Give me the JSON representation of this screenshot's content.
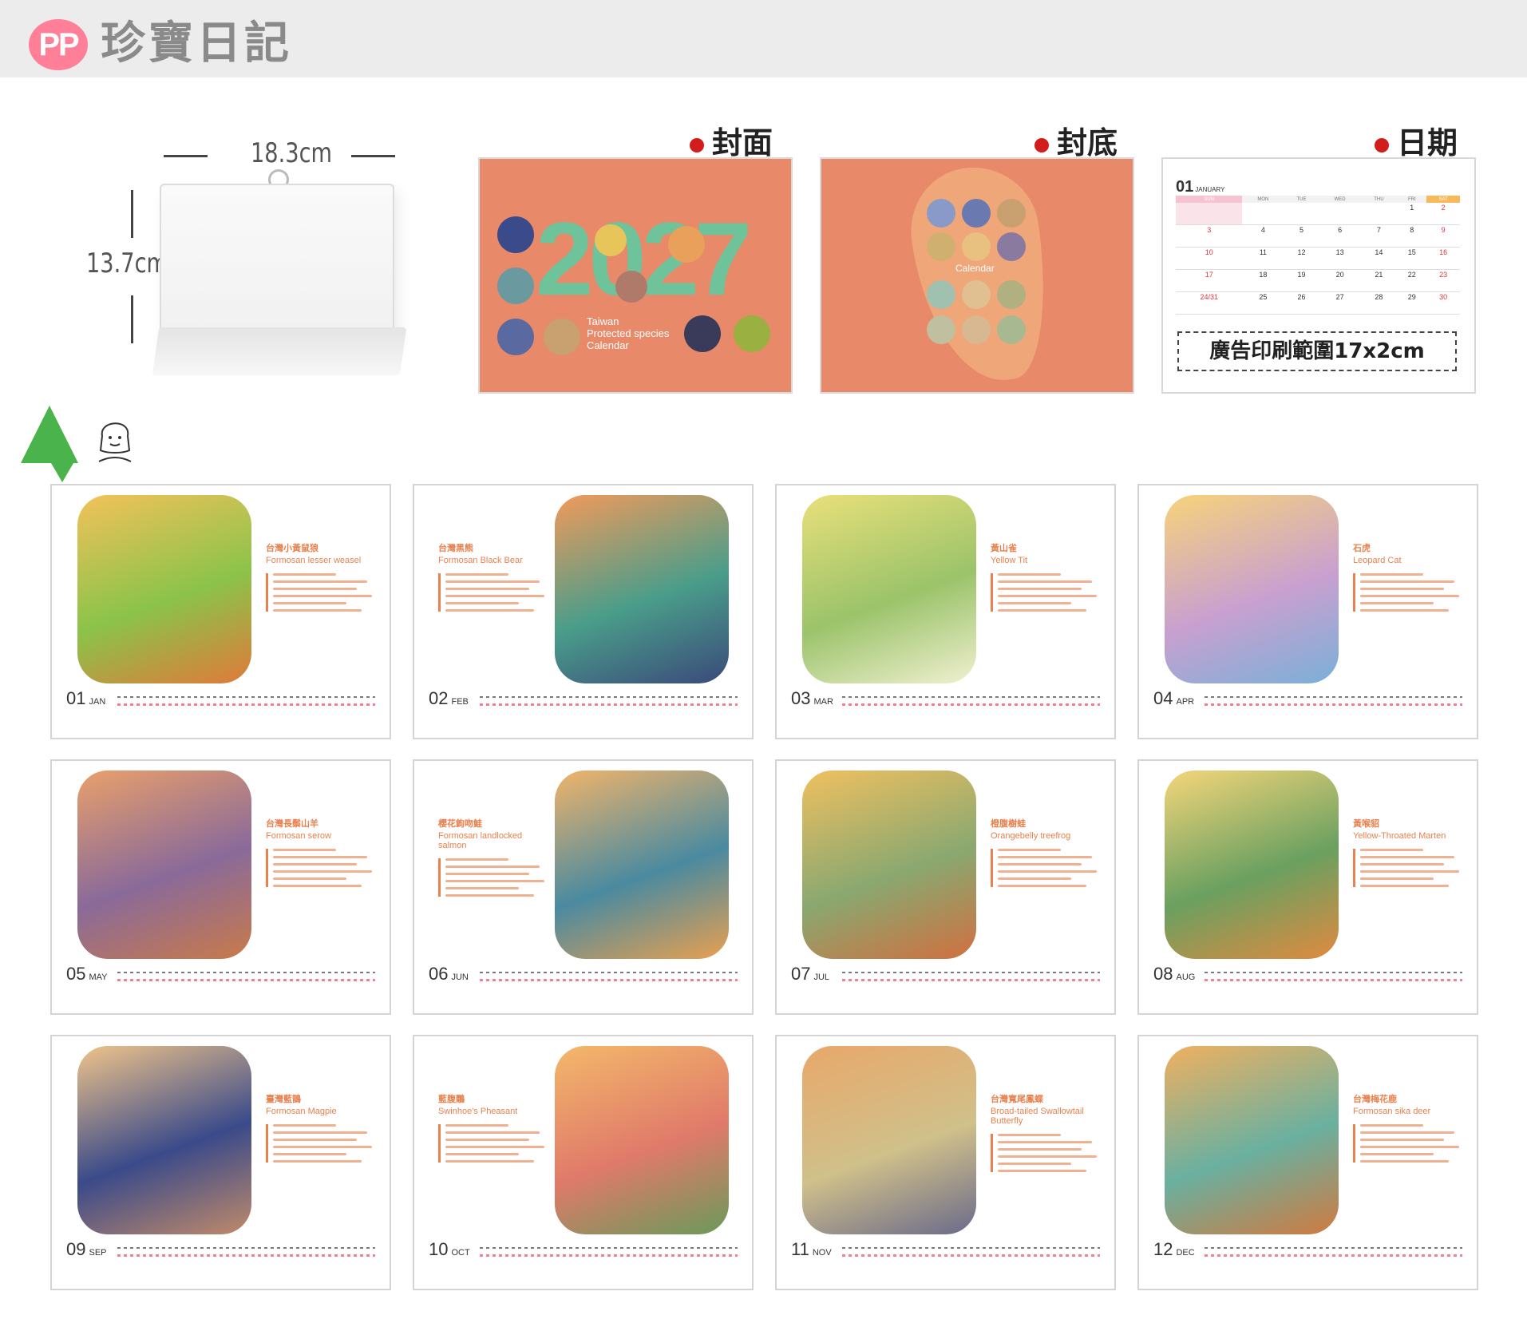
{
  "header": {
    "logo": "PP",
    "brand": "珍寶日記"
  },
  "product": {
    "width_label": "18.3cm",
    "height_label": "13.7cm"
  },
  "panels": {
    "cover_title": "封面",
    "back_title": "封底",
    "date_title": "日期"
  },
  "cover": {
    "year": "2027",
    "subtitle": [
      "Taiwan",
      "Protected species",
      "Calendar"
    ]
  },
  "back": {
    "label": "Calendar"
  },
  "date_page": {
    "month_num": "01",
    "month_name": "JANUARY",
    "weekdays": [
      "SUN",
      "MON",
      "TUE",
      "WED",
      "THU",
      "FRI",
      "SAT"
    ],
    "weeks": [
      [
        "",
        "",
        "",
        "",
        "",
        "1",
        "2"
      ],
      [
        "3",
        "4",
        "5",
        "6",
        "7",
        "8",
        "9"
      ],
      [
        "10",
        "11",
        "12",
        "13",
        "14",
        "15",
        "16"
      ],
      [
        "17",
        "18",
        "19",
        "20",
        "21",
        "22",
        "23"
      ],
      [
        "24/31",
        "25",
        "26",
        "27",
        "28",
        "29",
        "30"
      ]
    ],
    "ad_area": "廣告印刷範圍17x2cm"
  },
  "months": [
    {
      "num": "01",
      "abbr": "JAN",
      "zh": "台灣小黃鼠狼",
      "en": "Formosan lesser weasel",
      "colors": [
        "#f3c25a",
        "#8bc34a",
        "#e07a3a"
      ]
    },
    {
      "num": "02",
      "abbr": "FEB",
      "zh": "台灣黑熊",
      "en": "Formosan Black Bear",
      "colors": [
        "#f29a5a",
        "#4a9d8a",
        "#3a4a7a"
      ]
    },
    {
      "num": "03",
      "abbr": "MAR",
      "zh": "黃山雀",
      "en": "Yellow Tit",
      "colors": [
        "#e9e07a",
        "#9bc36a",
        "#f0f0d0"
      ]
    },
    {
      "num": "04",
      "abbr": "APR",
      "zh": "石虎",
      "en": "Leopard Cat",
      "colors": [
        "#f7d37a",
        "#c9a0d0",
        "#7ab0d8"
      ]
    },
    {
      "num": "05",
      "abbr": "MAY",
      "zh": "台灣長鬃山羊",
      "en": "Formosan serow",
      "colors": [
        "#e9a06a",
        "#8a6a9a",
        "#c97a4a"
      ]
    },
    {
      "num": "06",
      "abbr": "JUN",
      "zh": "櫻花鉤吻鮭",
      "en": "Formosan landlocked salmon",
      "colors": [
        "#f2b46a",
        "#4a8aa0",
        "#e8a050"
      ]
    },
    {
      "num": "07",
      "abbr": "JUL",
      "zh": "橙腹樹蛙",
      "en": "Orangebelly treefrog",
      "colors": [
        "#f0c060",
        "#8aa870",
        "#d07040"
      ]
    },
    {
      "num": "08",
      "abbr": "AUG",
      "zh": "黃喉貂",
      "en": "Yellow-Throated Marten",
      "colors": [
        "#f5d67a",
        "#6aa060",
        "#e08a40"
      ]
    },
    {
      "num": "09",
      "abbr": "SEP",
      "zh": "臺灣藍鵲",
      "en": "Formosan Magpie",
      "colors": [
        "#f0c48a",
        "#3a4a8a",
        "#c08a6a"
      ]
    },
    {
      "num": "10",
      "abbr": "OCT",
      "zh": "藍腹鷴",
      "en": "Swinhoe's Pheasant",
      "colors": [
        "#f3b86a",
        "#e07a6a",
        "#6a9a5a"
      ]
    },
    {
      "num": "11",
      "abbr": "NOV",
      "zh": "台灣寬尾鳳蝶",
      "en": "Broad-tailed Swallowtail Butterfly",
      "colors": [
        "#e8a86a",
        "#d0c08a",
        "#6a6a8a"
      ]
    },
    {
      "num": "12",
      "abbr": "DEC",
      "zh": "台灣梅花鹿",
      "en": "Formosan sika deer",
      "colors": [
        "#f0b060",
        "#6ab0a0",
        "#d07a40"
      ]
    }
  ]
}
